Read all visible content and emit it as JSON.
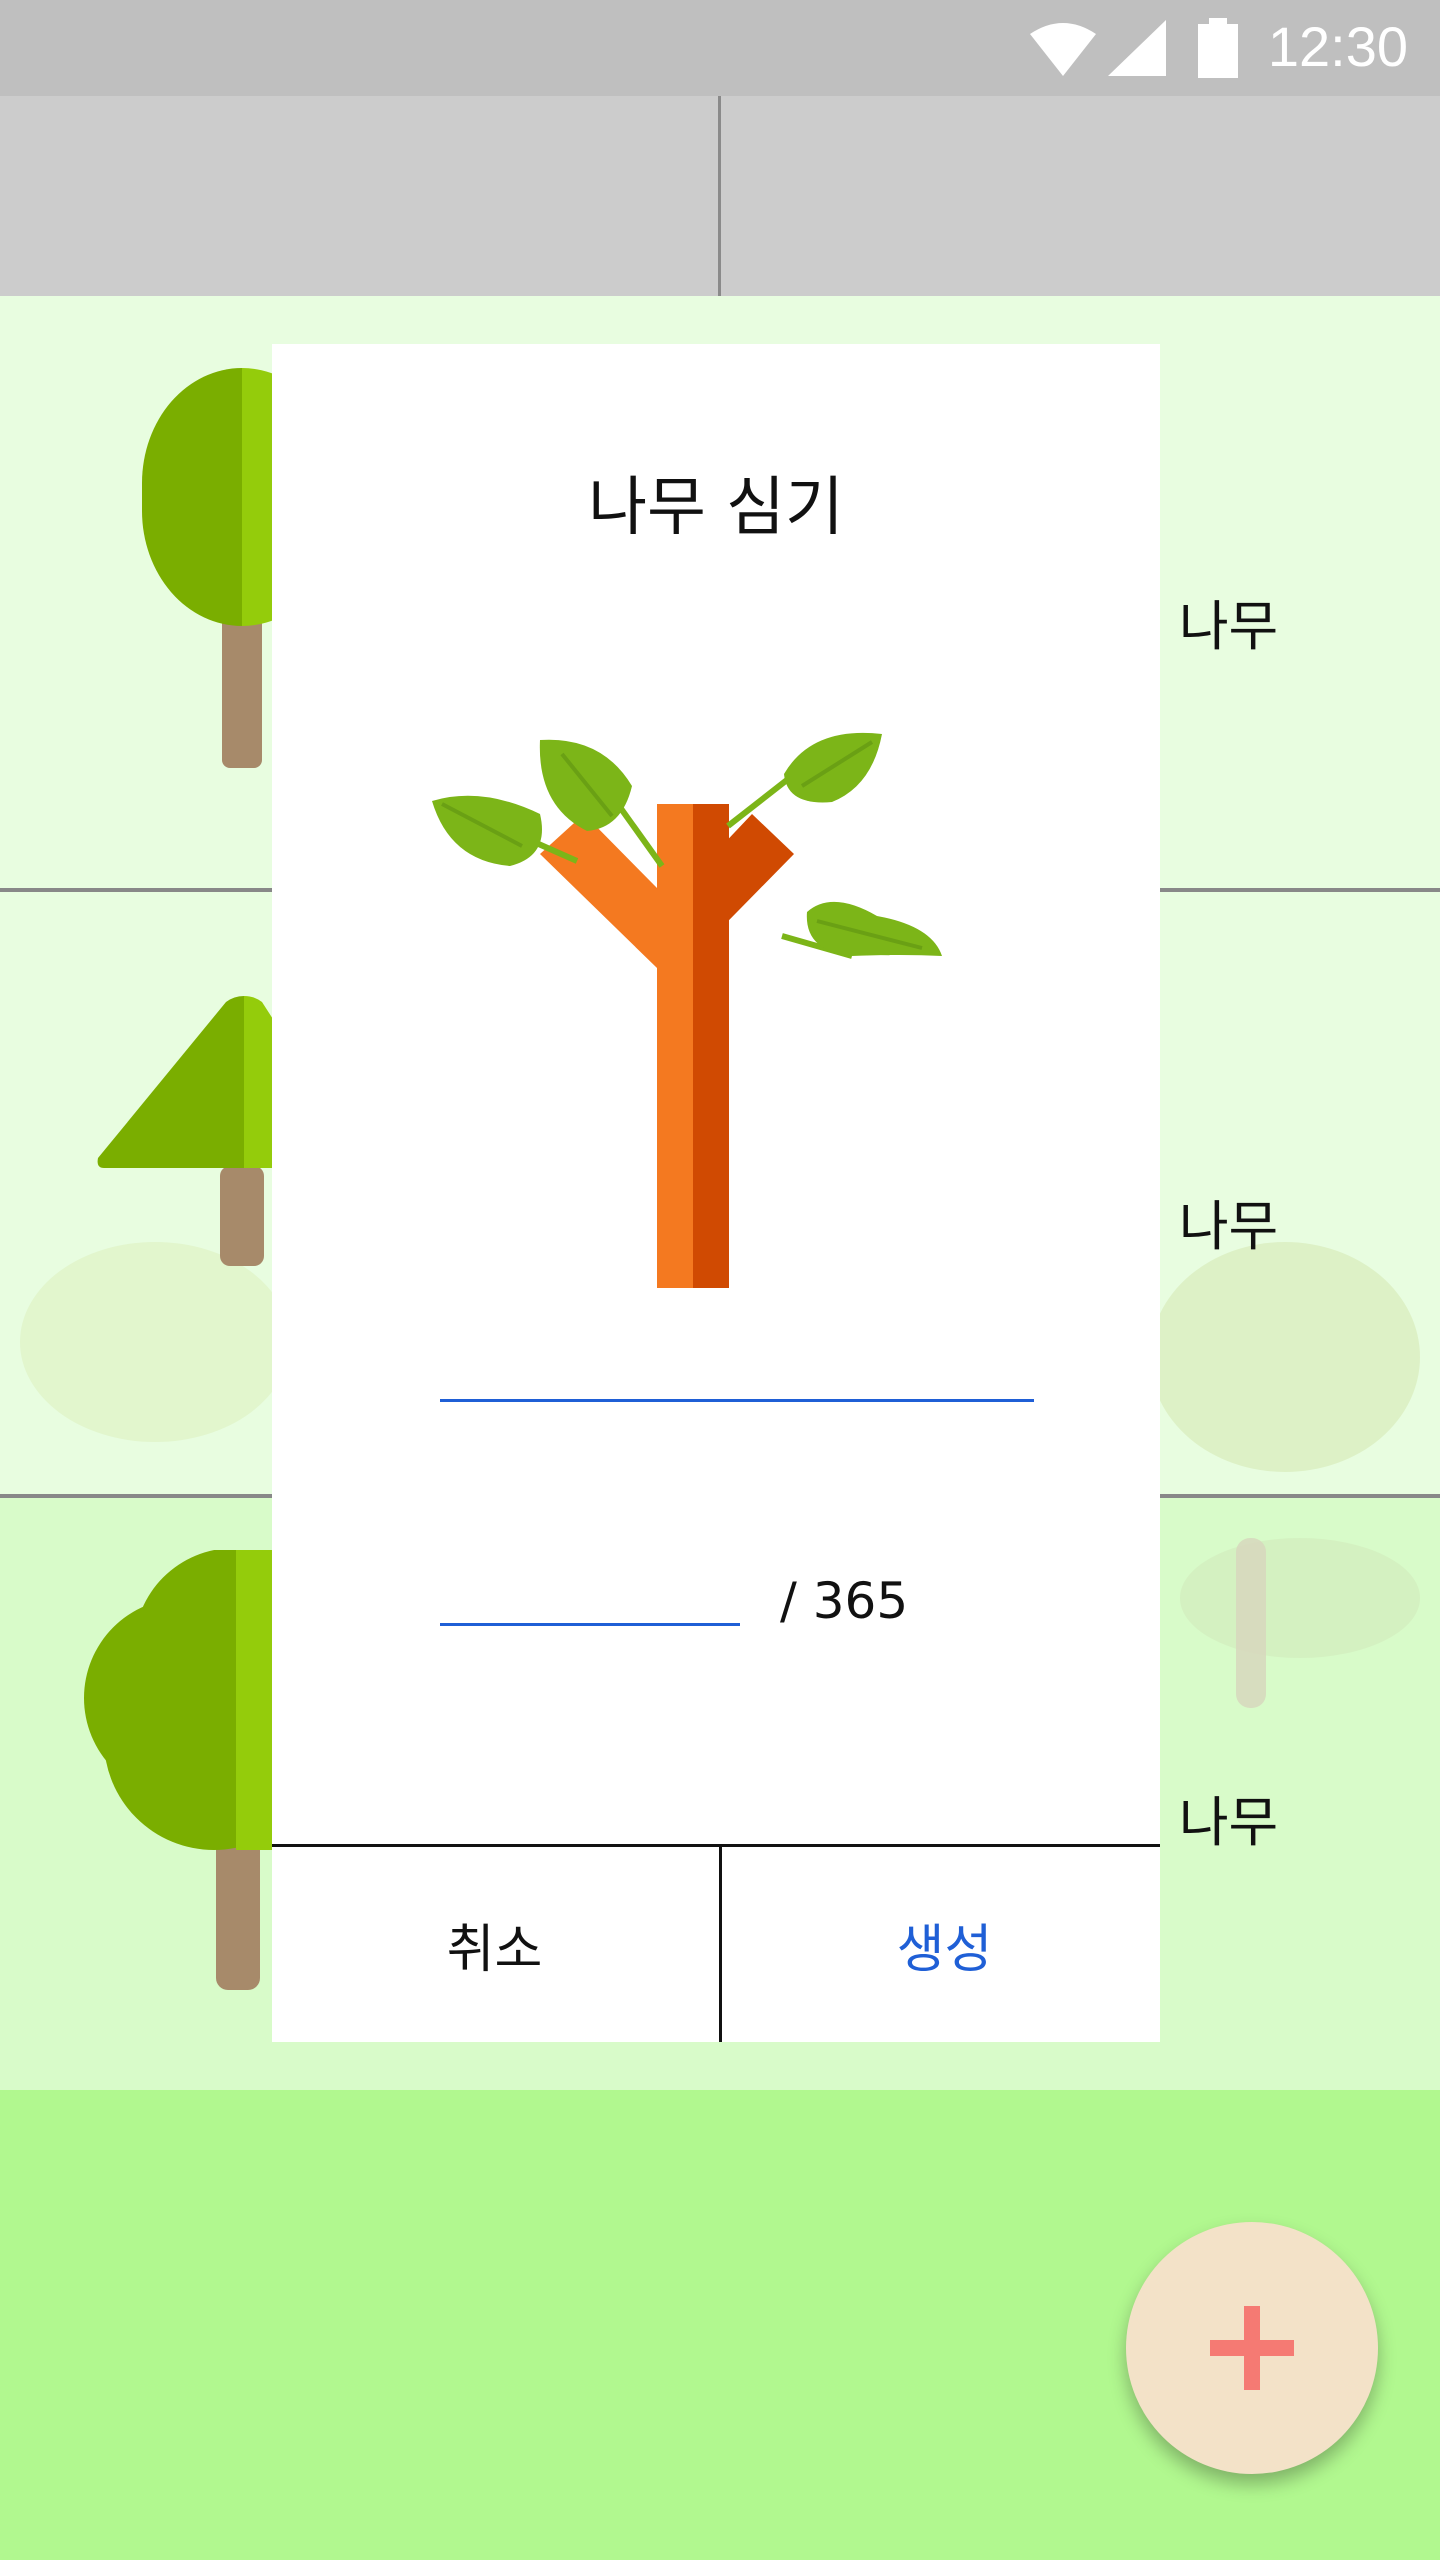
{
  "status_bar": {
    "time": "12:30",
    "icons": [
      "wifi-icon",
      "cell-signal-icon",
      "battery-icon"
    ]
  },
  "tabs": {
    "items": [
      "",
      ""
    ]
  },
  "tree_list": {
    "rows": [
      {
        "label": "은 나무",
        "tree_icon": "round-tree-icon"
      },
      {
        "label": "은 나무",
        "tree_icon": "cone-tree-icon"
      },
      {
        "label": "은 나무",
        "tree_icon": "bushy-tree-icon"
      }
    ]
  },
  "dialog": {
    "title": "나무 심기",
    "illustration": "sapling-icon",
    "name_input": {
      "value": "",
      "placeholder": ""
    },
    "days_input": {
      "value": "",
      "placeholder": ""
    },
    "days_suffix": "/ 365",
    "cancel_label": "취소",
    "create_label": "생성"
  },
  "fab": {
    "icon": "plus-icon"
  },
  "colors": {
    "row_bg_1": "#e8fde0",
    "row_bg_3": "#d8fbc9",
    "bottom_bg": "#b1f88f",
    "accent": "#1f5fd6",
    "fab_bg": "#f3e2c8",
    "fab_plus": "#f57a73"
  }
}
